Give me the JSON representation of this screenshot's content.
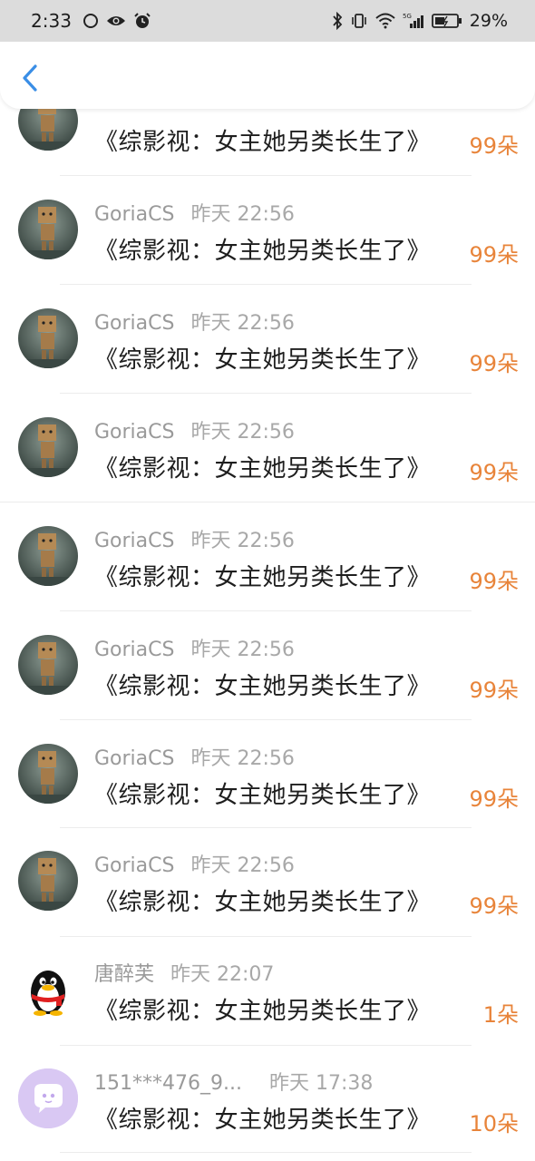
{
  "status_bar": {
    "time": "2:33",
    "battery": "29%"
  },
  "header": {
    "back_icon": "chevron-left-icon",
    "accent": "#3a8ee6"
  },
  "colors": {
    "amount": "#e8843a",
    "name": "#9a9a9a",
    "message": "#1e1e1e"
  },
  "items": [
    {
      "name": "",
      "time": "",
      "message": "《综影视：女主她另类长生了》",
      "amount": "99朵",
      "avatar": "danbo"
    },
    {
      "name": "GoriaCS",
      "time": "昨天 22:56",
      "message": "《综影视：女主她另类长生了》",
      "amount": "99朵",
      "avatar": "danbo"
    },
    {
      "name": "GoriaCS",
      "time": "昨天 22:56",
      "message": "《综影视：女主她另类长生了》",
      "amount": "99朵",
      "avatar": "danbo"
    },
    {
      "name": "GoriaCS",
      "time": "昨天 22:56",
      "message": "《综影视：女主她另类长生了》",
      "amount": "99朵",
      "avatar": "danbo"
    },
    {
      "name": "GoriaCS",
      "time": "昨天 22:56",
      "message": "《综影视：女主她另类长生了》",
      "amount": "99朵",
      "avatar": "danbo"
    },
    {
      "name": "GoriaCS",
      "time": "昨天 22:56",
      "message": "《综影视：女主她另类长生了》",
      "amount": "99朵",
      "avatar": "danbo"
    },
    {
      "name": "GoriaCS",
      "time": "昨天 22:56",
      "message": "《综影视：女主她另类长生了》",
      "amount": "99朵",
      "avatar": "danbo"
    },
    {
      "name": "GoriaCS",
      "time": "昨天 22:56",
      "message": "《综影视：女主她另类长生了》",
      "amount": "99朵",
      "avatar": "danbo"
    },
    {
      "name": "唐醉芙",
      "time": "昨天 22:07",
      "message": "《综影视：女主她另类长生了》",
      "amount": "1朵",
      "avatar": "penguin"
    },
    {
      "name": "151***476_9...",
      "time": "昨天 17:38",
      "message": "《综影视：女主她另类长生了》",
      "amount": "10朵",
      "avatar": "chat-bubble"
    }
  ]
}
